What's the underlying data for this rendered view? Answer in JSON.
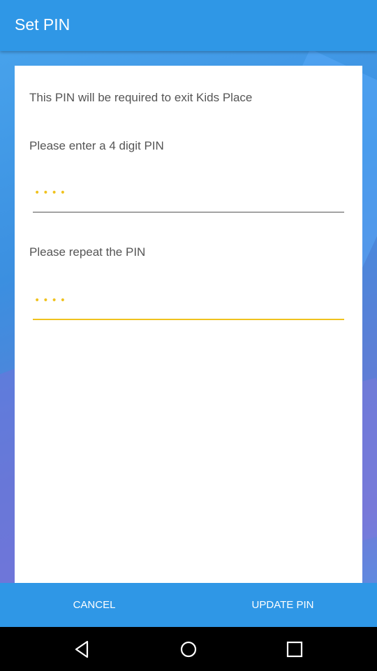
{
  "app_bar": {
    "title": "Set PIN"
  },
  "card": {
    "description": "This PIN will be required to exit Kids Place",
    "enter_label": "Please enter a 4 digit PIN",
    "enter_value": "••••",
    "repeat_label": "Please repeat the PIN",
    "repeat_value": "••••"
  },
  "actions": {
    "cancel_label": "CANCEL",
    "update_label": "UPDATE PIN"
  },
  "nav": {
    "back_icon": "back-triangle-icon",
    "home_icon": "home-circle-icon",
    "recent_icon": "recent-square-icon"
  },
  "colors": {
    "primary": "#2f97e6",
    "accent": "#f0c21e"
  }
}
